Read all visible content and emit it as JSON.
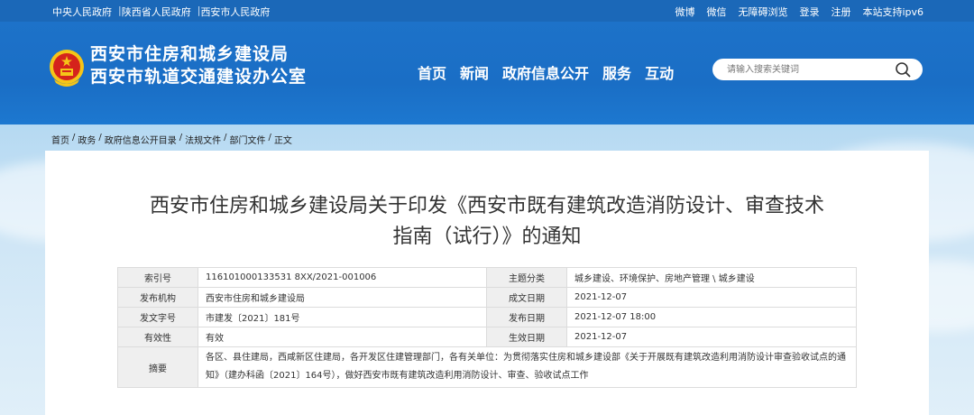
{
  "topbar": {
    "left_links": [
      "中央人民政府",
      "陕西省人民政府",
      "西安市人民政府"
    ],
    "separator": "|",
    "right_links": [
      "微博",
      "微信",
      "无障碍浏览",
      "登录",
      "注册",
      "本站支持ipv6"
    ]
  },
  "header": {
    "org_line1": "西安市住房和城乡建设局",
    "org_line2": "西安市轨道交通建设办公室",
    "nav": [
      "首页",
      "新闻",
      "政府信息公开",
      "服务",
      "互动"
    ],
    "search_placeholder": "请输入搜索关键词"
  },
  "breadcrumb": [
    "首页",
    "政务",
    "政府信息公开目录",
    "法规文件",
    "部门文件",
    "正文"
  ],
  "breadcrumb_sep": "/",
  "article": {
    "title_line1": "西安市住房和城乡建设局关于印发《西安市既有建筑改造消防设计、审查技术",
    "title_line2": "指南（试行）》的通知"
  },
  "meta": {
    "index_label": "索引号",
    "index_value": "116101000133531 8XX/2021-001006",
    "topic_label": "主题分类",
    "topic_value": "城乡建设、环境保护、房地产管理 \\ 城乡建设",
    "issuer_label": "发布机构",
    "issuer_value": "西安市住房和城乡建设局",
    "created_label": "成文日期",
    "created_value": "2021-12-07",
    "docno_label": "发文字号",
    "docno_value": "市建发〔2021〕181号",
    "published_label": "发布日期",
    "published_value": "2021-12-07 18:00",
    "validity_label": "有效性",
    "validity_value": "有效",
    "effective_label": "生效日期",
    "effective_value": "2021-12-07",
    "abstract_label": "摘要",
    "abstract_value": "各区、县住建局，西咸新区住建局，各开发区住建管理部门，各有关单位：为贯彻落实住房和城乡建设部《关于开展既有建筑改造利用消防设计审查验收试点的通知》（建办科函〔2021〕164号），做好西安市既有建筑改造利用消防设计、审查、验收试点工作"
  },
  "colors": {
    "header_blue": "#1d72c9",
    "topbar_blue": "#1b68b8",
    "emblem_red": "#d5231c",
    "emblem_gold": "#f5c518"
  }
}
